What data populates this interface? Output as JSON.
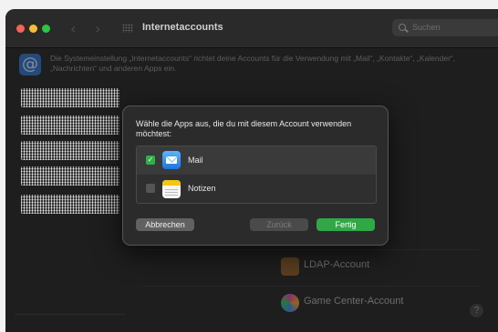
{
  "window": {
    "title": "Internetaccounts",
    "search_placeholder": "Suchen",
    "back_arrow": "‹",
    "forward_arrow": "›"
  },
  "info": {
    "icon_glyph": "@",
    "text": "Die Systemeinstellung „Internetaccounts“ richtet deine Accounts für die Verwendung mit „Mail“, „Kontakte“, „Kalender“, „Nachrichten“ und anderen Apps ein."
  },
  "accounts": [
    {
      "label": "LDAP-Account",
      "icon": "ldap-icon"
    },
    {
      "label": "Game Center-Account",
      "icon": "game-center-icon"
    }
  ],
  "help_label": "?",
  "dialog": {
    "prompt": "Wähle die Apps aus, die du mit diesem Account verwenden möchtest:",
    "apps": [
      {
        "name": "Mail",
        "checked": true,
        "check_glyph": "✓",
        "icon": "mail-icon"
      },
      {
        "name": "Notizen",
        "checked": false,
        "check_glyph": "",
        "icon": "notes-icon"
      }
    ],
    "buttons": {
      "cancel": "Abbrechen",
      "back": "Zurück",
      "done": "Fertig"
    }
  },
  "colors": {
    "accent_green": "#2fa946",
    "window_bg": "#1e1e1e",
    "dialog_bg": "#2b2b2b"
  }
}
